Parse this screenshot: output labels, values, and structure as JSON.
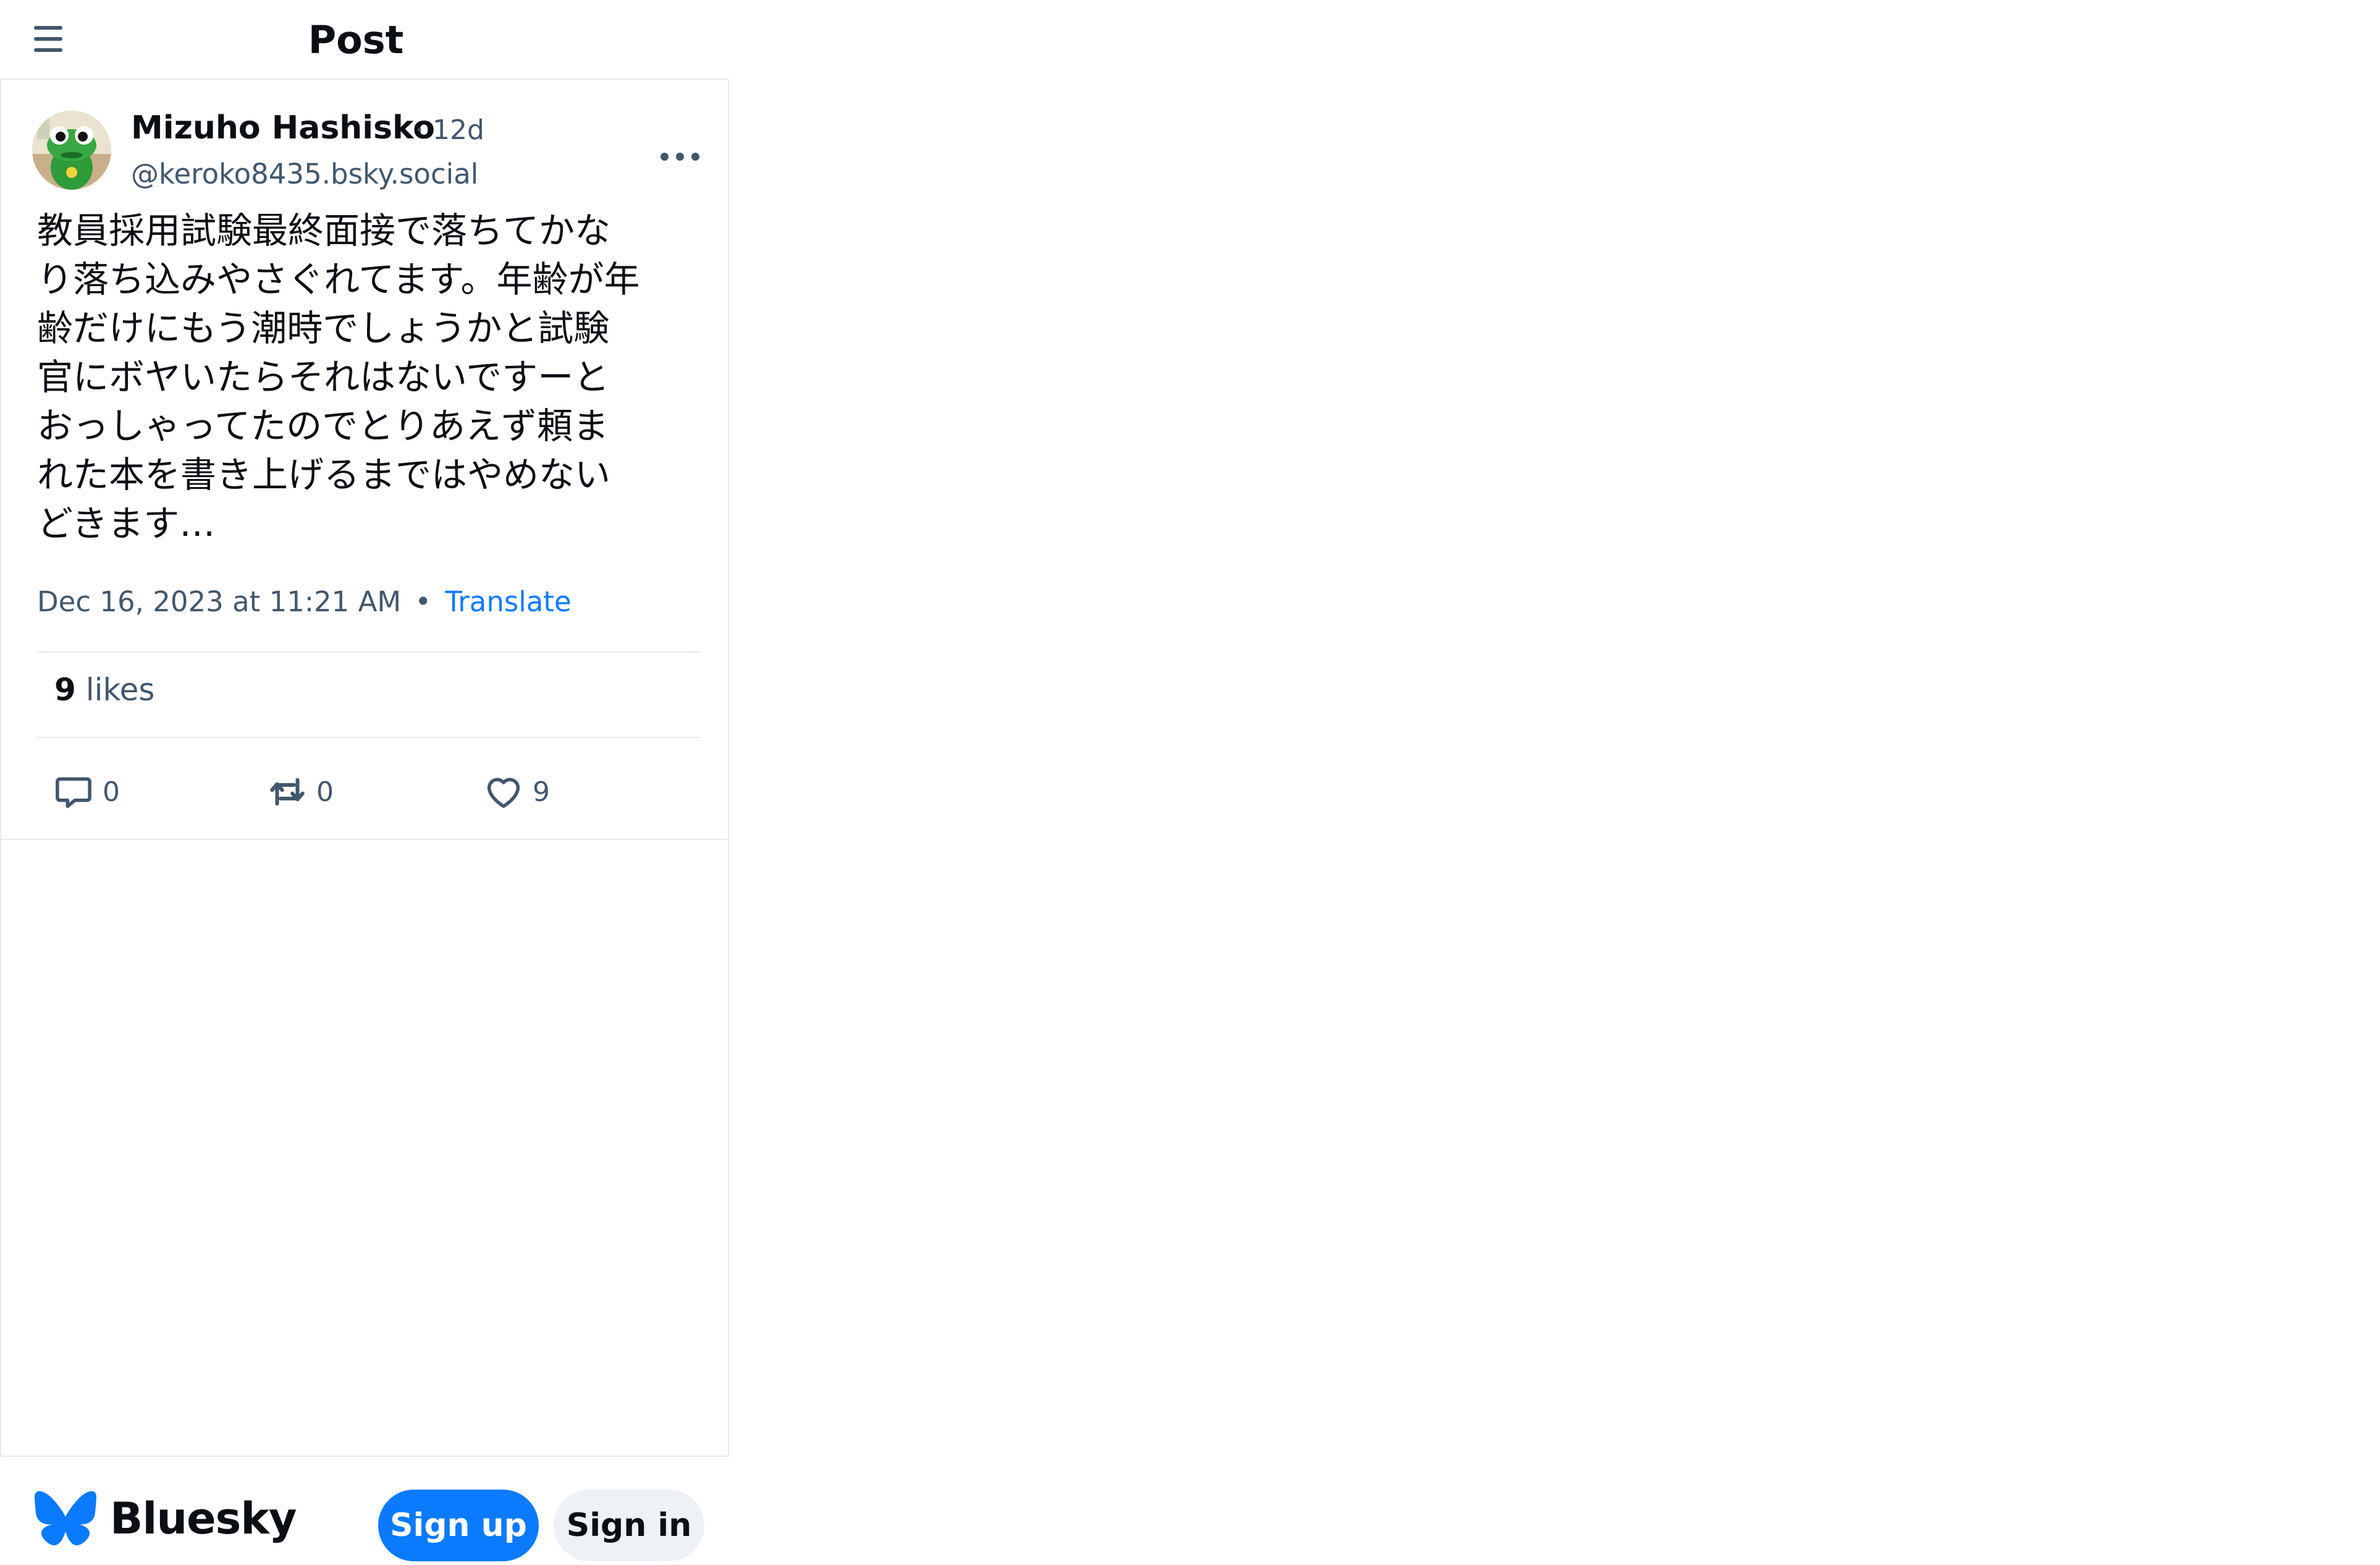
{
  "header": {
    "title": "Post"
  },
  "post": {
    "author": {
      "display_name": "Mizuho Hashisko",
      "age": "· 12d",
      "handle": "@keroko8435.bsky.social",
      "avatar_icon": "frog-avatar"
    },
    "text": "教員採用試験最終面接で落ちてかな\nり落ち込みやさぐれてます。年齢が年\n齢だけにもう潮時でしょうかと試験\n官にボヤいたらそれはないですーと\nおっしゃってたのでとりあえず頼ま\nれた本を書き上げるまではやめない\nどきます…",
    "timestamp": "Dec 16, 2023 at 11:21 AM",
    "separator": "•",
    "translate_label": "Translate",
    "likes_count": "9",
    "likes_label": "likes",
    "actions": {
      "reply": {
        "icon": "speech-bubble-icon",
        "count": "0"
      },
      "repost": {
        "icon": "repost-icon",
        "count": "0"
      },
      "like": {
        "icon": "heart-icon",
        "count": "9"
      }
    }
  },
  "footer": {
    "brand": "Bluesky",
    "brand_icon": "butterfly-icon",
    "brand_color": "#0a7aff",
    "signup_label": "Sign up",
    "signin_label": "Sign in"
  }
}
